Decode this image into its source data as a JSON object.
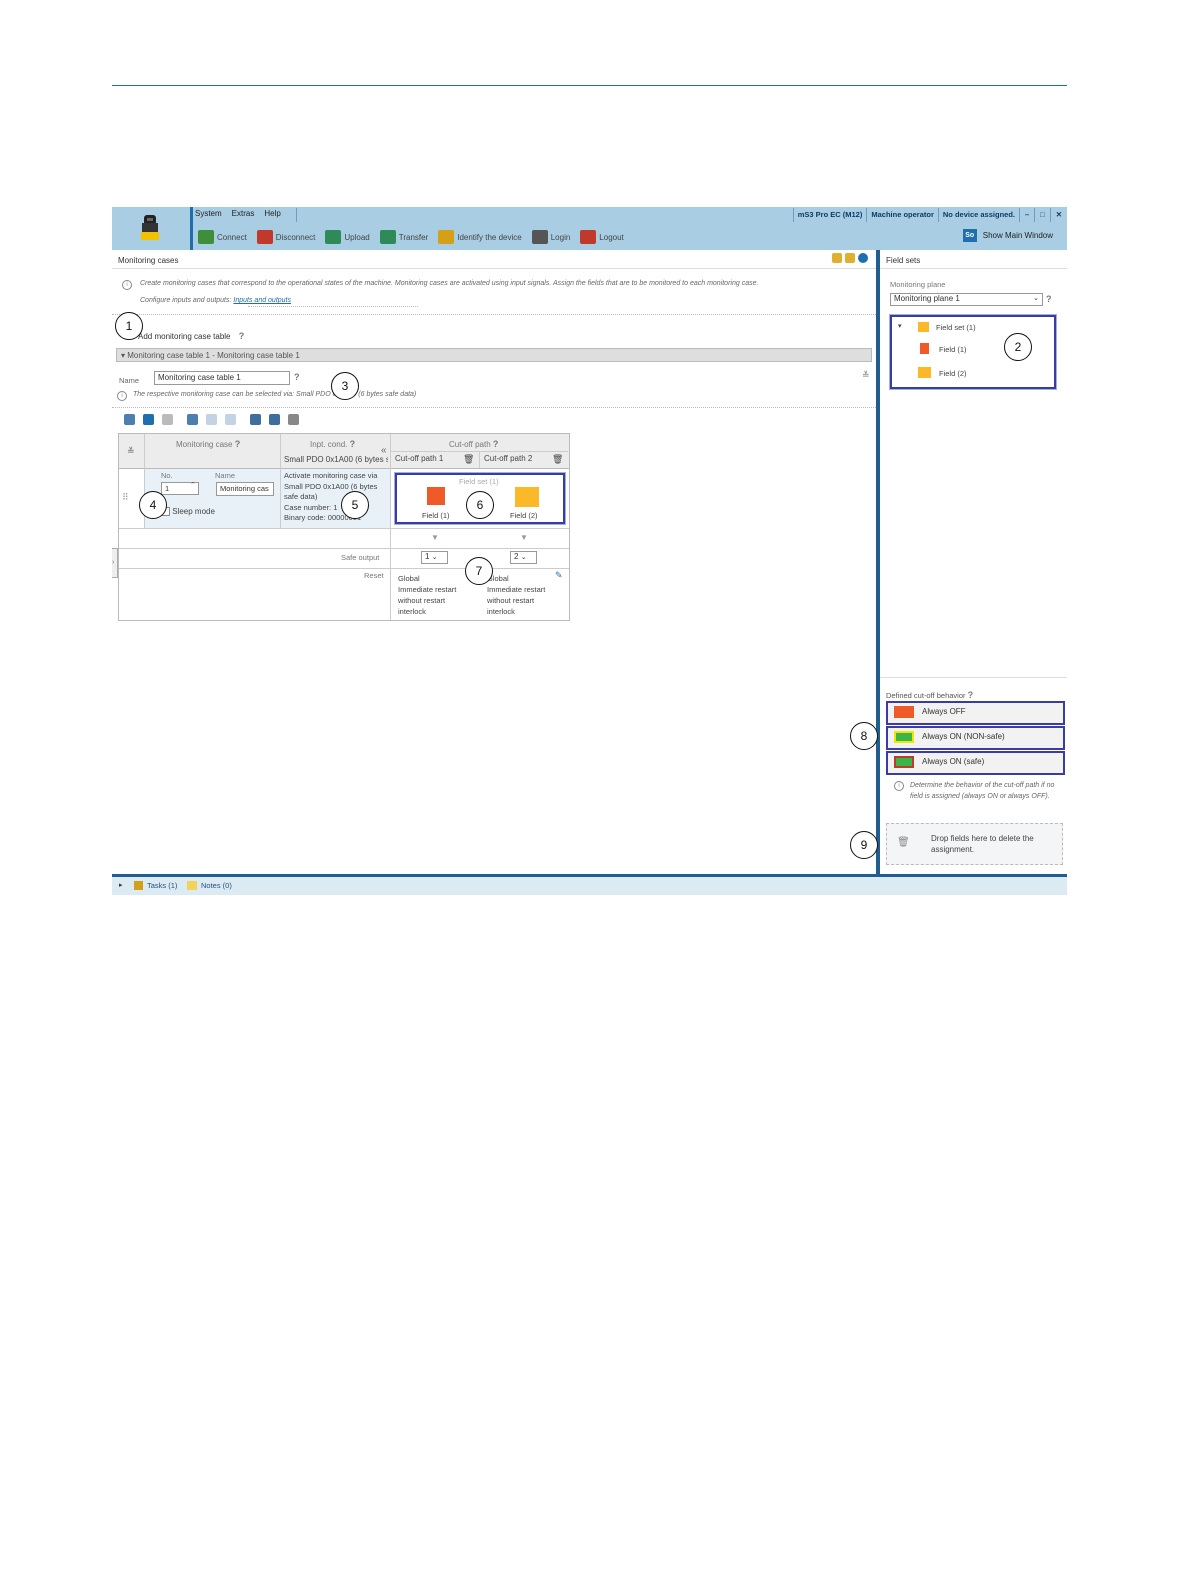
{
  "app": {
    "menu": [
      "System",
      "Extras",
      "Help"
    ],
    "status": [
      "mS3 Pro EC (M12)",
      "Machine operator",
      "No device assigned."
    ],
    "window_buttons": [
      "–",
      "□",
      "✕"
    ],
    "tools": [
      {
        "label": "Connect",
        "icon": "connect-icon",
        "color": "#3f8f3a"
      },
      {
        "label": "Disconnect",
        "icon": "disconnect-icon",
        "color": "#c0392b"
      },
      {
        "label": "Upload",
        "icon": "upload-icon",
        "color": "#2e8b57"
      },
      {
        "label": "Transfer",
        "icon": "transfer-icon",
        "color": "#2e8b57"
      },
      {
        "label": "Identify the device",
        "icon": "identify-icon",
        "color": "#d4a017"
      },
      {
        "label": "Login",
        "icon": "login-icon",
        "color": "#555555"
      },
      {
        "label": "Logout",
        "icon": "logout-icon",
        "color": "#c0392b"
      }
    ],
    "show_main_badge": "So",
    "show_main_label": "Show Main Window"
  },
  "monitoring": {
    "panel_title": "Monitoring cases",
    "intro_text": "Create monitoring cases that correspond to the operational states of the machine. Monitoring cases are activated using input signals. Assign the fields that are to be monitored to each monitoring case.",
    "configure_text": "Configure inputs and outputs:",
    "configure_link": "Inputs and outputs",
    "add_table_label": "Add monitoring case table",
    "section_title": "Monitoring case table 1 - Monitoring case table 1",
    "name_label": "Name",
    "name_value": "Monitoring case table 1",
    "selected_via_text": "The respective monitoring case can be selected via: Small PDO 0x1A00 (6 bytes safe data)",
    "table": {
      "col_monitoring_case": "Monitoring case",
      "col_input_cond": "Inpt. cond.",
      "col_input_sub": "Small PDO 0x1A00 (6 bytes s",
      "col_cutoff": "Cut-off path",
      "cutoff_path_1": "Cut-off path 1",
      "cutoff_path_2": "Cut-off path 2",
      "no_label": "No.",
      "no_value": "1",
      "name_label": "Name",
      "name_value": "Monitoring cas",
      "sleep_mode": "Sleep mode",
      "input_desc": [
        "Activate monitoring case via",
        "Small PDO 0x1A00 (6 bytes",
        "safe data)",
        "Case number: 1",
        "Binary code: 00000001"
      ],
      "field_set_label": "Field set (1)",
      "field_1": "Field (1)",
      "field_2": "Field (2)",
      "safe_output_label": "Safe output",
      "safe_output_1": "1",
      "safe_output_2": "2",
      "reset_label": "Reset",
      "reset_1": [
        "Global",
        "Immediate restart",
        "without restart",
        "interlock"
      ],
      "reset_2": [
        "Global",
        "Immediate restart",
        "without restart",
        "interlock"
      ]
    }
  },
  "fieldsets": {
    "panel_title": "Field sets",
    "plane_label": "Monitoring plane",
    "plane_value": "Monitoring plane 1",
    "tree_root": "Field set (1)",
    "tree_items": [
      {
        "label": "Field (1)",
        "color": "#f05a28"
      },
      {
        "label": "Field (2)",
        "color": "#fbb829"
      }
    ],
    "behavior_title": "Defined cut-off behavior",
    "behaviors": [
      {
        "label": "Always OFF",
        "color": "#f05a28",
        "border": "#f05a28"
      },
      {
        "label": "Always ON (NON-safe)",
        "color": "#39b54a",
        "border": "#f4e500"
      },
      {
        "label": "Always ON (safe)",
        "color": "#39b54a",
        "border": "#c0392b"
      }
    ],
    "behavior_note": "Determine the behavior of the cut-off path if no field is assigned (always ON or always OFF).",
    "drop_text": "Drop fields here to delete the assignment."
  },
  "taskbar": {
    "tasks": "Tasks (1)",
    "notes": "Notes (0)"
  },
  "callouts": [
    "1",
    "2",
    "3",
    "4",
    "5",
    "6",
    "7",
    "8",
    "9"
  ]
}
